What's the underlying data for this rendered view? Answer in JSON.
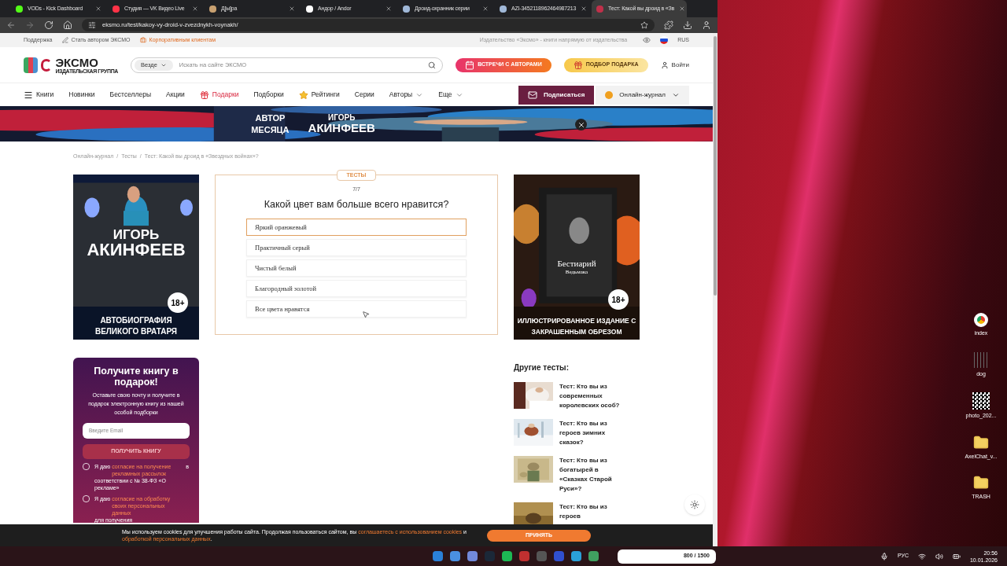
{
  "browser": {
    "tabs": [
      {
        "title": "VODs - Kick Dashboard",
        "selected": false,
        "color": "#53fc18"
      },
      {
        "title": "Студия — VK Видео Live",
        "selected": false,
        "color": "#ff3347"
      },
      {
        "title": "Д[ы]ра",
        "selected": false,
        "color": "#c8a070"
      },
      {
        "title": "Андор / Andor",
        "selected": false,
        "color": "#ffffff"
      },
      {
        "title": "Дроид-охранник серии",
        "selected": false,
        "color": "#a0b8d8"
      },
      {
        "title": "AZI-3452118962464987213",
        "selected": false,
        "color": "#a0b8d8"
      },
      {
        "title": "Тест: Какой вы дроид в «Зв",
        "selected": true,
        "color": "#c0304a"
      }
    ],
    "url": "eksmo.ru/test/kakoy-vy-droid-v-zvezdnykh-voynakh/"
  },
  "topbar": {
    "links": [
      {
        "label": "Поддержка",
        "kind": "plain"
      },
      {
        "label": "Стать автором ЭКСМО",
        "kind": "pen"
      },
      {
        "label": "Корпоративным клиентам",
        "kind": "corporate"
      }
    ],
    "tagline": "Издательство «Эксмо» - книги напрямую от издательства",
    "language": "RUS"
  },
  "header": {
    "logo": {
      "name": "ЭКСМО",
      "subtitle": "ИЗДАТЕЛЬСКАЯ ГРУППА"
    },
    "search": {
      "scope": "Везде",
      "placeholder": "Искать на сайте ЭКСМО"
    },
    "buttons": [
      {
        "label": "ВСТРЕЧИ С АВТОРАМИ",
        "kind": "meetings"
      },
      {
        "label": "ПОДБОР ПОДАРКА",
        "kind": "gift"
      }
    ],
    "login": "Войти"
  },
  "nav": {
    "items": [
      {
        "label": "Книги",
        "kind": "menu"
      },
      {
        "label": "Новинки",
        "kind": "plain"
      },
      {
        "label": "Бестселлеры",
        "kind": "plain"
      },
      {
        "label": "Акции",
        "kind": "plain"
      },
      {
        "label": "Подарки",
        "kind": "gift"
      },
      {
        "label": "Подборки",
        "kind": "plain"
      },
      {
        "label": "Рейтинги",
        "kind": "rating"
      },
      {
        "label": "Серии",
        "kind": "plain"
      },
      {
        "label": "Авторы",
        "kind": "dropdown"
      },
      {
        "label": "Еще",
        "kind": "dropdown"
      }
    ],
    "subscribe": "Подписаться",
    "journal": "Онлайн-журнал"
  },
  "banner": {
    "line_1": "АВТОР",
    "line_2": "МЕСЯЦА",
    "name_1": "ИГОРЬ",
    "name_2": "АКИНФЕЕВ"
  },
  "breadcrumbs": {
    "separator": "/",
    "items": [
      "Онлайн-журнал",
      "Тесты",
      "Тест: Какой вы дроид в «Звездных войнах»?"
    ]
  },
  "left_ad": {
    "title_1": "ИГОРЬ",
    "title_2": "АКИНФЕЕВ",
    "age": "18+",
    "caption": "АВТОБИОГРАФИЯ ВЕЛИКОГО ВРАТАРЯ"
  },
  "quiz": {
    "tag": "ТЕСТЫ",
    "progress": "7/7",
    "question": "Какой цвет вам больше всего нравится?",
    "options": [
      {
        "label": "Яркий оранжевый",
        "selected": true
      },
      {
        "label": "Практичный серый",
        "selected": false
      },
      {
        "label": "Чистый белый",
        "selected": false
      },
      {
        "label": "Благородный золотой",
        "selected": false
      },
      {
        "label": "Все цвета нравятся",
        "selected": false
      }
    ]
  },
  "right_ad": {
    "title_1": "Бестиарий",
    "title_2": "Ведьмака",
    "age": "18+",
    "caption": "ИЛЛЮСТРИРОВАННОЕ ИЗДАНИЕ С ЗАКРАШЕННЫМ ОБРЕЗОМ"
  },
  "promo": {
    "title": "Получите книгу в подарок!",
    "text": "Оставьте свою почту и получите в подарок электронную книгу из нашей особой подборки",
    "email_placeholder": "Введите Email",
    "button": "ПОЛУЧИТЬ КНИГУ",
    "consents": [
      {
        "checked": false,
        "before": "Я даю ",
        "link": "согласие на получение рекламных рассылок",
        "after": " в соответствии с № 38-ФЗ «О рекламе»"
      },
      {
        "checked": false,
        "before": "Я даю ",
        "link": "согласие на обработку своих персональных данных",
        "after": " для получения"
      }
    ]
  },
  "other_tests": {
    "title": "Другие тесты:",
    "items": [
      {
        "title": "Тест: Кто вы из современных королевских особ?"
      },
      {
        "title": "Тест: Кто вы из героев зимних сказок?"
      },
      {
        "title": "Тест: Кто вы из богатырей в «Сказках Старой Руси»?"
      },
      {
        "title": "Тест: Кто вы из героев"
      }
    ]
  },
  "cookie": {
    "text": "Мы используем cookies для улучшения работы сайта. Продолжая пользоваться сайтом, вы ",
    "link_1": "соглашаетесь с использованием cookies",
    "middle": " и ",
    "link_2": "обработкой персональных данных",
    "end": ".",
    "button": "ПРИНЯТЬ"
  },
  "desktop_icons": [
    {
      "label": "index",
      "kind": "chrome"
    },
    {
      "label": "dog",
      "kind": "file"
    },
    {
      "label": "photo_202...",
      "kind": "qr"
    },
    {
      "label": "AxelChat_v...",
      "kind": "folder"
    },
    {
      "label": "TRASH",
      "kind": "folder"
    }
  ],
  "taskbar": {
    "widget": "800 / 1500",
    "language": "РУС",
    "time": "20:56",
    "date": "10.01.2026"
  }
}
